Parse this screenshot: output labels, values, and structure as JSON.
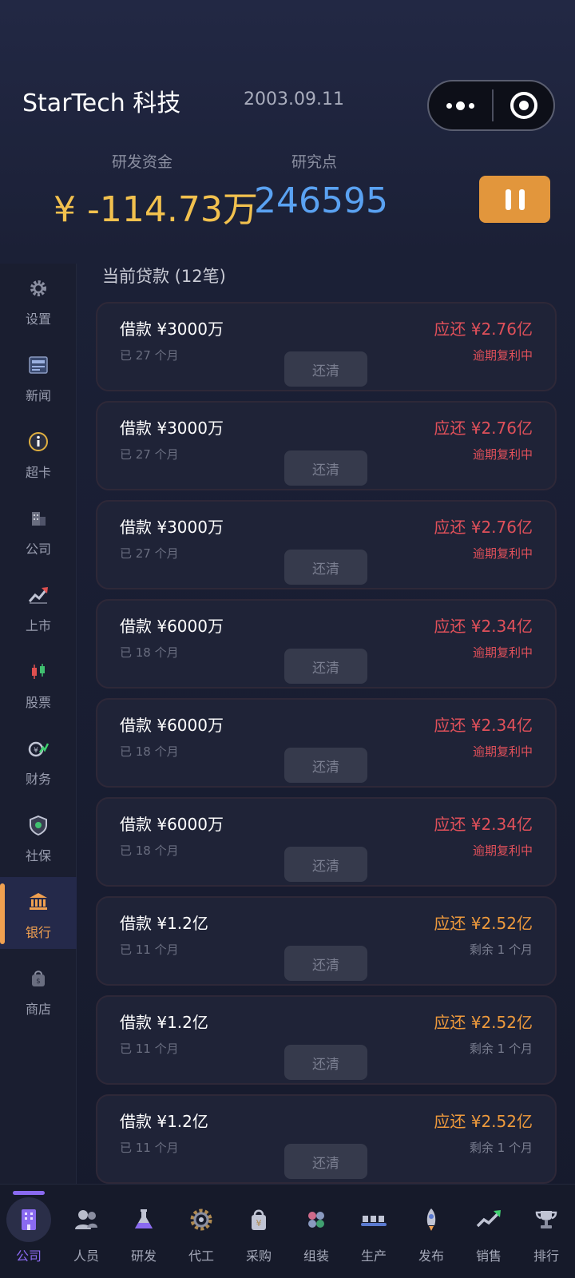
{
  "header": {
    "company": "StarTech 科技",
    "date": "2003.09.11",
    "funds_label": "研发资金",
    "funds_value": "¥ -114.73万",
    "points_label": "研究点",
    "points_value": "246595"
  },
  "capsule": {
    "more_icon": "more-dots-icon",
    "close_icon": "target-circle-icon"
  },
  "sidebar": {
    "items": [
      {
        "label": "设置",
        "icon": "gear-icon"
      },
      {
        "label": "新闻",
        "icon": "newspaper-icon"
      },
      {
        "label": "超卡",
        "icon": "info-circle-icon"
      },
      {
        "label": "公司",
        "icon": "building-icon"
      },
      {
        "label": "上市",
        "icon": "trend-up-icon"
      },
      {
        "label": "股票",
        "icon": "candlestick-icon"
      },
      {
        "label": "财务",
        "icon": "finance-icon"
      },
      {
        "label": "社保",
        "icon": "shield-icon"
      },
      {
        "label": "银行",
        "icon": "bank-icon",
        "active": true
      },
      {
        "label": "商店",
        "icon": "shop-bag-icon"
      }
    ]
  },
  "section_title": "当前贷款 (12笔)",
  "loans": [
    {
      "amount": "借款 ¥3000万",
      "months": "已 27 个月",
      "due": "应还 ¥2.76亿",
      "status": "逾期复利中",
      "overdue": true,
      "button": "还清"
    },
    {
      "amount": "借款 ¥3000万",
      "months": "已 27 个月",
      "due": "应还 ¥2.76亿",
      "status": "逾期复利中",
      "overdue": true,
      "button": "还清"
    },
    {
      "amount": "借款 ¥3000万",
      "months": "已 27 个月",
      "due": "应还 ¥2.76亿",
      "status": "逾期复利中",
      "overdue": true,
      "button": "还清"
    },
    {
      "amount": "借款 ¥6000万",
      "months": "已 18 个月",
      "due": "应还 ¥2.34亿",
      "status": "逾期复利中",
      "overdue": true,
      "button": "还清"
    },
    {
      "amount": "借款 ¥6000万",
      "months": "已 18 个月",
      "due": "应还 ¥2.34亿",
      "status": "逾期复利中",
      "overdue": true,
      "button": "还清"
    },
    {
      "amount": "借款 ¥6000万",
      "months": "已 18 个月",
      "due": "应还 ¥2.34亿",
      "status": "逾期复利中",
      "overdue": true,
      "button": "还清"
    },
    {
      "amount": "借款 ¥1.2亿",
      "months": "已 11 个月",
      "due": "应还 ¥2.52亿",
      "status": "剩余 1 个月",
      "overdue": false,
      "button": "还清"
    },
    {
      "amount": "借款 ¥1.2亿",
      "months": "已 11 个月",
      "due": "应还 ¥2.52亿",
      "status": "剩余 1 个月",
      "overdue": false,
      "button": "还清"
    },
    {
      "amount": "借款 ¥1.2亿",
      "months": "已 11 个月",
      "due": "应还 ¥2.52亿",
      "status": "剩余 1 个月",
      "overdue": false,
      "button": "还清"
    }
  ],
  "tabbar": {
    "tabs": [
      {
        "label": "公司",
        "icon": "office-building-icon",
        "active": true
      },
      {
        "label": "人员",
        "icon": "people-icon"
      },
      {
        "label": "研发",
        "icon": "flask-icon"
      },
      {
        "label": "代工",
        "icon": "gear-wheel-icon"
      },
      {
        "label": "采购",
        "icon": "shopping-bag-icon"
      },
      {
        "label": "组装",
        "icon": "components-icon"
      },
      {
        "label": "生产",
        "icon": "conveyor-icon"
      },
      {
        "label": "发布",
        "icon": "rocket-icon"
      },
      {
        "label": "销售",
        "icon": "sales-chart-icon"
      },
      {
        "label": "排行",
        "icon": "trophy-icon"
      }
    ]
  },
  "colors": {
    "funds": "#f2c14e",
    "points": "#5aa2f2",
    "overdue": "#e0505a",
    "due_ok": "#ee9a3c",
    "accent": "#8a6af0",
    "sidebar_active": "#f0a050"
  }
}
